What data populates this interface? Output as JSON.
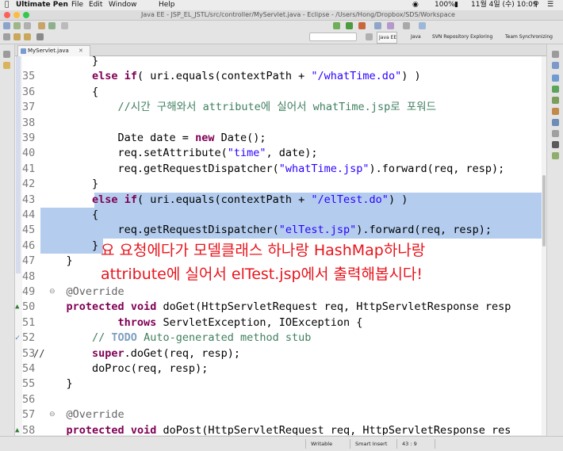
{
  "menubar": {
    "app": "Ultimate Pen",
    "items": [
      "File",
      "Edit",
      "Window",
      "Help"
    ],
    "status": {
      "battery": "100%",
      "datetime": "11월 4일 (수)  10:09"
    }
  },
  "window": {
    "title": "Java EE - JSP_EL_JSTL/src/controller/MyServlet.java - Eclipse - /Users/Hong/Dropbox/SDS/Workspace"
  },
  "perspectives": [
    "Java EE",
    "Java",
    "SVN Repository Exploring",
    "Team Synchronizing"
  ],
  "editor": {
    "tab": "MyServlet.java",
    "lines": [
      {
        "n": "",
        "code": "        }",
        "hl": false
      },
      {
        "n": "35",
        "code": "        else if( uri.equals(contextPath + \"/whatTime.do\") )",
        "hl": false
      },
      {
        "n": "36",
        "code": "        {",
        "hl": false
      },
      {
        "n": "37",
        "code": "            //시간 구해와서 attribute에 실어서 whatTime.jsp로 포워드",
        "hl": false
      },
      {
        "n": "38",
        "code": "",
        "hl": false
      },
      {
        "n": "39",
        "code": "            Date date = new Date();",
        "hl": false
      },
      {
        "n": "40",
        "code": "            req.setAttribute(\"time\", date);",
        "hl": false
      },
      {
        "n": "41",
        "code": "            req.getRequestDispatcher(\"whatTime.jsp\").forward(req, resp);",
        "hl": false
      },
      {
        "n": "42",
        "code": "        }",
        "hl": false
      },
      {
        "n": "43",
        "code": "        else if( uri.equals(contextPath + \"/elTest.do\") )",
        "hl": true
      },
      {
        "n": "44",
        "code": "        {",
        "hl": true
      },
      {
        "n": "45",
        "code": "            req.getRequestDispatcher(\"elTest.jsp\").forward(req, resp);",
        "hl": true
      },
      {
        "n": "46",
        "code": "        }",
        "hl": true
      },
      {
        "n": "47",
        "code": "    }",
        "hl": false
      },
      {
        "n": "48",
        "code": "",
        "hl": false
      },
      {
        "n": "49",
        "code": "    @Override",
        "hl": false
      },
      {
        "n": "50",
        "code": "    protected void doGet(HttpServletRequest req, HttpServletResponse resp",
        "hl": false
      },
      {
        "n": "51",
        "code": "            throws ServletException, IOException {",
        "hl": false
      },
      {
        "n": "52",
        "code": "        // TODO Auto-generated method stub",
        "hl": false
      },
      {
        "n": "53",
        "code": "        super.doGet(req, resp);",
        "hl": false
      },
      {
        "n": "54",
        "code": "        doProc(req, resp);",
        "hl": false
      },
      {
        "n": "55",
        "code": "    }",
        "hl": false
      },
      {
        "n": "56",
        "code": "",
        "hl": false
      },
      {
        "n": "57",
        "code": "    @Override",
        "hl": false
      },
      {
        "n": "58",
        "code": "    protected void doPost(HttpServletRequest req, HttpServletResponse res",
        "hl": false
      }
    ],
    "comment_marker": "//"
  },
  "annotation": {
    "line1": "요 요청에다가 모델클래스 하나랑 HashMap하나랑",
    "line2": "attribute에 실어서 elTest.jsp에서 출력해봅시다!"
  },
  "status": {
    "mode": "Writable",
    "insert": "Smart Insert",
    "position": "43 : 9"
  },
  "colors": {
    "highlight": "#b4cdee",
    "annotation": "#e8141c",
    "keyword": "#7f0055",
    "string": "#2a00ff",
    "comment": "#3f7f5f"
  }
}
